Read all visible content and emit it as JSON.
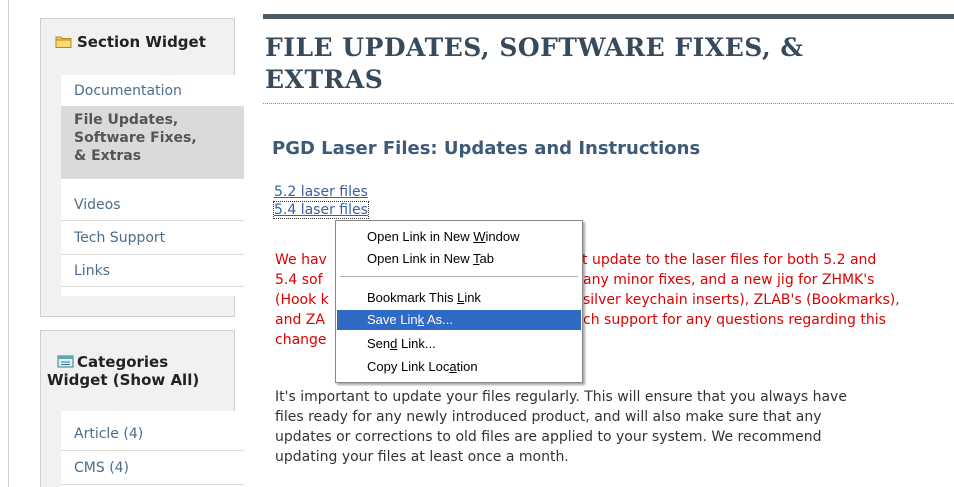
{
  "sidebar": {
    "section_widget": {
      "title": "Section Widget",
      "icon": "folder-icon",
      "items": [
        {
          "label": "Documentation",
          "active": false
        },
        {
          "label": "File Updates,",
          "active": true
        },
        {
          "label": "Videos",
          "active": false
        },
        {
          "label": "Tech Support",
          "active": false
        },
        {
          "label": "Links",
          "active": false
        }
      ],
      "active_lines": [
        "File Updates,",
        "Software Fixes,",
        "& Extras"
      ]
    },
    "categories_widget": {
      "title_line1": "Categories",
      "title_line2": "Widget (Show All)",
      "icon": "categories-icon",
      "items": [
        {
          "label": "Article (4)"
        },
        {
          "label": "CMS (4)"
        }
      ]
    }
  },
  "main": {
    "title_line1": "FILE UPDATES, SOFTWARE FIXES, &",
    "title_line2": "EXTRAS",
    "subtitle": "PGD Laser Files: Updates and Instructions",
    "links": [
      "5.2 laser files",
      "5.4 laser files"
    ],
    "notice_lines": [
      {
        "left": "We hav",
        "right": "t update to the laser files for both 5.2 and"
      },
      {
        "left": "5.4 sof",
        "right": "any minor fixes, and a new jig for ZHMK's"
      },
      {
        "left": "(Hook k",
        "right": "silver keychain inserts), ZLAB's (Bookmarks),"
      },
      {
        "left": "and ZA",
        "right": "ch support for any questions regarding this"
      },
      {
        "left": "change",
        "right": ""
      }
    ],
    "body_lines": [
      "It's important to update your files regularly. This will ensure that you always have",
      "files ready for any newly introduced product, and will also make sure that any",
      "updates or corrections to old files are applied to your system. We recommend",
      "updating your files at least once a month."
    ]
  },
  "context_menu": {
    "items": [
      {
        "pre": "Open Link in New ",
        "key": "W",
        "post": "indow"
      },
      {
        "pre": "Open Link in New ",
        "key": "T",
        "post": "ab"
      },
      {
        "pre": "Bookmark This ",
        "key": "L",
        "post": "ink"
      },
      {
        "pre": "Save Lin",
        "key": "k",
        "post": " As..."
      },
      {
        "pre": "Sen",
        "key": "d",
        "post": " Link..."
      },
      {
        "pre": "Copy Link Loc",
        "key": "a",
        "post": "tion"
      }
    ],
    "highlighted_index": 3
  },
  "colors": {
    "link": "#3b5fa0",
    "notice_red": "#dd0000",
    "title": "#374a5c",
    "menu_highlight": "#316ac5"
  }
}
